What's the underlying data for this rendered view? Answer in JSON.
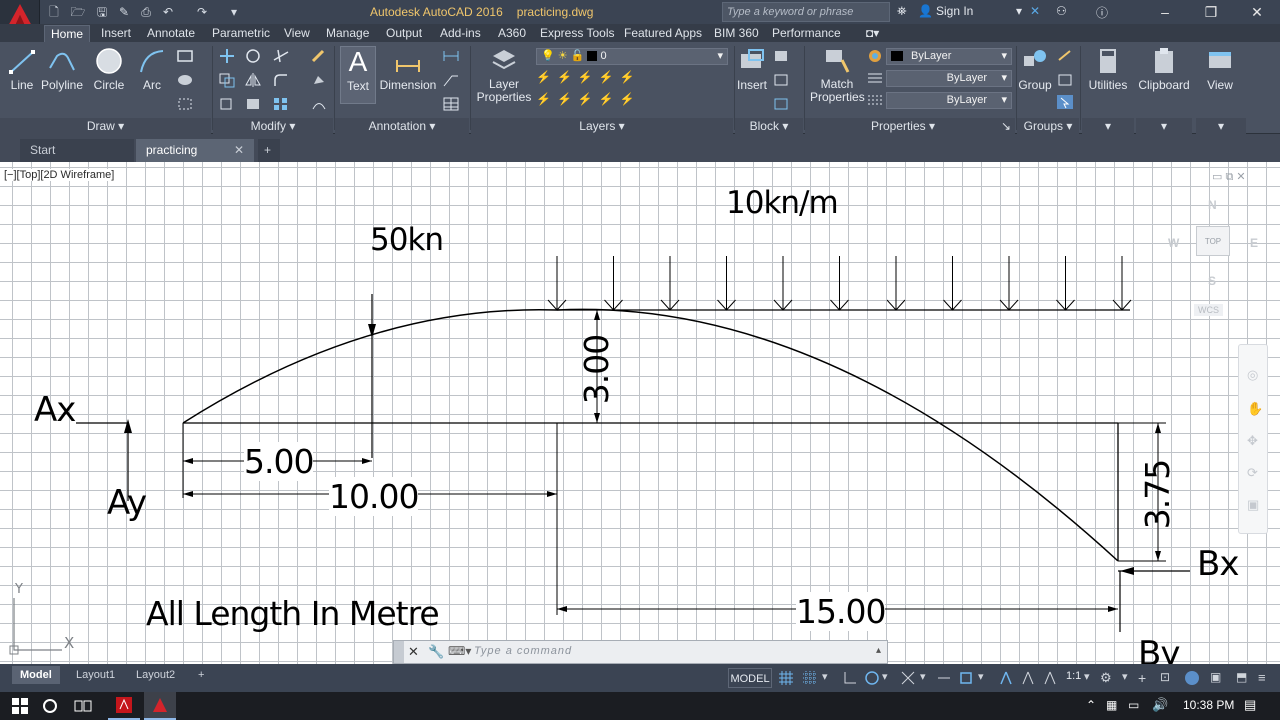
{
  "window": {
    "app_name": "Autodesk AutoCAD 2016",
    "file_name": "practicing.dwg",
    "search_placeholder": "Type a keyword or phrase",
    "sign_in": "Sign In"
  },
  "ribbon_tabs": [
    "Home",
    "Insert",
    "Annotate",
    "Parametric",
    "View",
    "Manage",
    "Output",
    "Add-ins",
    "A360",
    "Express Tools",
    "Featured Apps",
    "BIM 360",
    "Performance"
  ],
  "ribbon": {
    "draw_tools": [
      "Line",
      "Polyline",
      "Circle",
      "Arc"
    ],
    "annotation_tools": [
      "Text",
      "Dimension"
    ],
    "layer_properties": "Layer\nProperties",
    "layer_value": "0",
    "insert": "Insert",
    "match_properties": "Match\nProperties",
    "prop_color": "ByLayer",
    "prop_linetype": "ByLayer",
    "prop_lineweight": "ByLayer",
    "group": "Group",
    "utilities": "Utilities",
    "clipboard": "Clipboard",
    "view": "View",
    "panels": {
      "draw": "Draw",
      "modify": "Modify",
      "annotation": "Annotation",
      "layers": "Layers",
      "block": "Block",
      "properties": "Properties",
      "groups": "Groups"
    }
  },
  "file_tabs": [
    "Start",
    "practicing"
  ],
  "viewport_label": "[−][Top][2D Wireframe]",
  "viewcube": {
    "n": "N",
    "s": "S",
    "e": "E",
    "w": "W",
    "top": "TOP",
    "wcs": "WCS"
  },
  "drawing": {
    "load_distributed": "10kn/m",
    "load_point": "50kn",
    "reaction_ax": "Ax",
    "reaction_ay": "Ay",
    "reaction_bx": "Bx",
    "reaction_by": "By",
    "dim_5": "5.00",
    "dim_10": "10.00",
    "dim_15": "15.00",
    "dim_rise": "3.00",
    "dim_drop": "3.75",
    "note": "All  Length In Metre",
    "ucs_x": "X",
    "ucs_y": "Y"
  },
  "command_line": {
    "placeholder": "Type a command"
  },
  "layout_tabs": [
    "Model",
    "Layout1",
    "Layout2"
  ],
  "status": {
    "model": "MODEL",
    "scale": "1:1"
  },
  "taskbar": {
    "time": "10:38 PM"
  }
}
